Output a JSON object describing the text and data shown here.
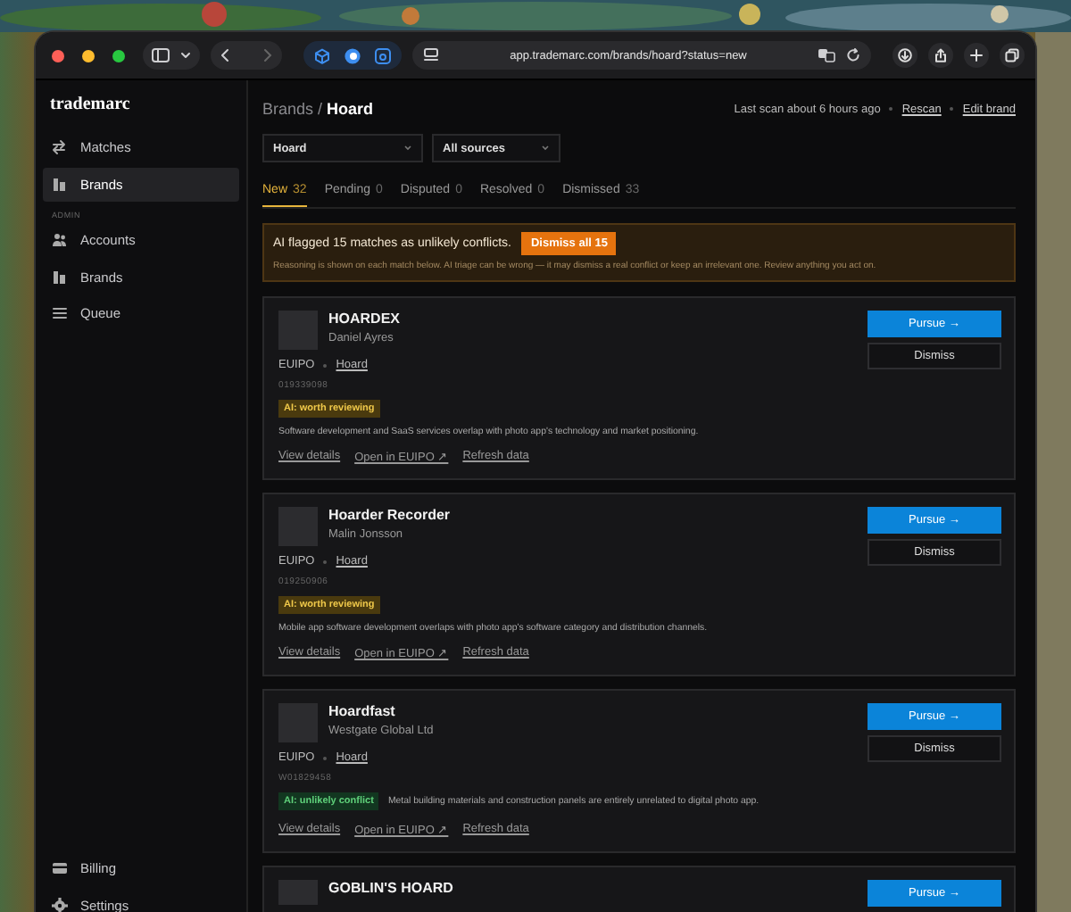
{
  "browser": {
    "url": "app.trademarc.com/brands/hoard?status=new"
  },
  "sidebar": {
    "logo": "trademarc",
    "items": [
      {
        "label": "Matches",
        "selected": false
      },
      {
        "label": "Brands",
        "selected": true
      }
    ],
    "section": "ADMIN",
    "admin_items": [
      {
        "label": "Accounts",
        "selected": false
      },
      {
        "label": "Brands",
        "selected": false
      },
      {
        "label": "Queue",
        "selected": false
      }
    ],
    "footer_items": [
      {
        "label": "Billing",
        "selected": false
      },
      {
        "label": "Settings",
        "selected": false
      }
    ]
  },
  "header": {
    "breadcrumb": {
      "parent": "Brands",
      "separator": "/",
      "current": "Hoard"
    },
    "last_scan": "Last scan about 6 hours ago",
    "links": [
      "Rescan",
      "Edit brand"
    ]
  },
  "filters": [
    {
      "value": "Hoard"
    },
    {
      "value": "All sources"
    }
  ],
  "tabs": [
    {
      "label": "New",
      "count": "32",
      "selected": true
    },
    {
      "label": "Pending",
      "count": "0",
      "selected": false
    },
    {
      "label": "Disputed",
      "count": "0",
      "selected": false
    },
    {
      "label": "Resolved",
      "count": "0",
      "selected": false
    },
    {
      "label": "Dismissed",
      "count": "33",
      "selected": false
    }
  ],
  "banner": {
    "message": "AI flagged 15 matches as unlikely conflicts.",
    "button": "Dismiss all 15",
    "note": "Reasoning is shown on each match below. AI triage can be wrong — it may dismiss a real conflict or keep an irrelevant one. Review anything you act on."
  },
  "cards": [
    {
      "title": "HOARDEX",
      "owner": "Daniel Ayres",
      "office": "EUIPO",
      "brand": "Hoard",
      "number": "019339098",
      "badge": {
        "kind": "review",
        "label": "AI: worth reviewing"
      },
      "reason": "Software development and SaaS services overlap with photo app's technology and market positioning.",
      "reason_inline": false,
      "links": [
        "View details",
        "Open in EUIPO ↗",
        "Refresh data"
      ],
      "pursue": "Pursue →",
      "dismiss": "Dismiss"
    },
    {
      "title": "Hoarder Recorder",
      "owner": "Malin Jonsson",
      "office": "EUIPO",
      "brand": "Hoard",
      "number": "019250906",
      "badge": {
        "kind": "review",
        "label": "AI: worth reviewing"
      },
      "reason": "Mobile app software development overlaps with photo app's software category and distribution channels.",
      "reason_inline": false,
      "links": [
        "View details",
        "Open in EUIPO ↗",
        "Refresh data"
      ],
      "pursue": "Pursue →",
      "dismiss": "Dismiss"
    },
    {
      "title": "Hoardfast",
      "owner": "Westgate Global Ltd",
      "office": "EUIPO",
      "brand": "Hoard",
      "number": "W01829458",
      "badge": {
        "kind": "unlikely",
        "label": "AI: unlikely conflict"
      },
      "reason": "Metal building materials and construction panels are entirely unrelated to digital photo app.",
      "reason_inline": true,
      "links": [
        "View details",
        "Open in EUIPO ↗",
        "Refresh data"
      ],
      "pursue": "Pursue →",
      "dismiss": "Dismiss"
    },
    {
      "title": "GOBLIN'S HOARD",
      "pursue": "Pursue →"
    }
  ]
}
